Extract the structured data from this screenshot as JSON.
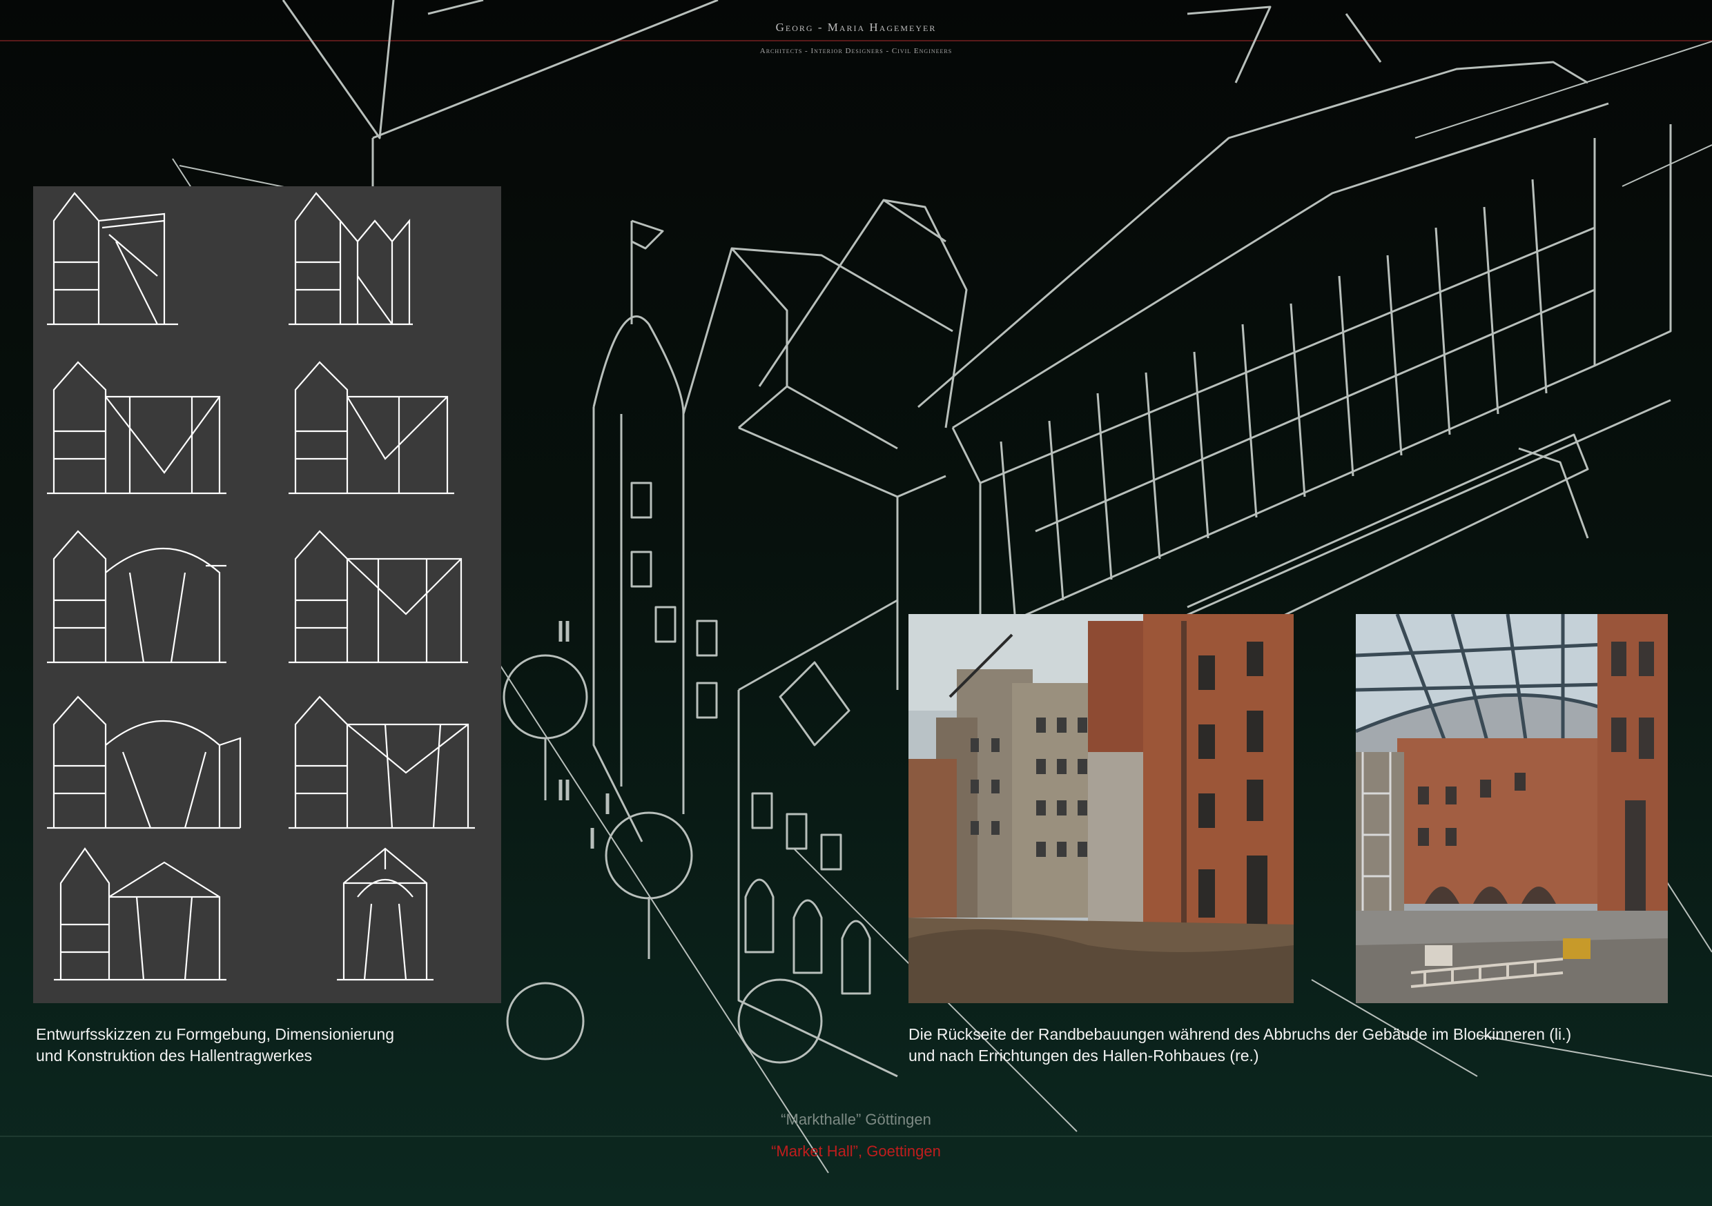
{
  "header": {
    "brand": "Georg - Maria Hagemeyer",
    "tagline": "Architects - Interior Designers - Civil Engineers"
  },
  "left_caption": "Entwurfsskizzen zu Formgebung, Dimensionierung\nund Konstruktion des Hallentragwerkes",
  "right_caption": "Die Rückseite der Randbebauungen während des Abbruchs der Gebäude im Blockinneren (li.)\nund nach Errichtungen des Hallen-Rohbaues (re.)",
  "footer": {
    "title_de": "“Markthalle” Göttingen",
    "title_en": "“Market Hall”, Goettingen"
  },
  "colors": {
    "accent_red": "#c01d1d",
    "line_grey": "#b8bfbb",
    "panel_grey": "#3a3a3a"
  }
}
